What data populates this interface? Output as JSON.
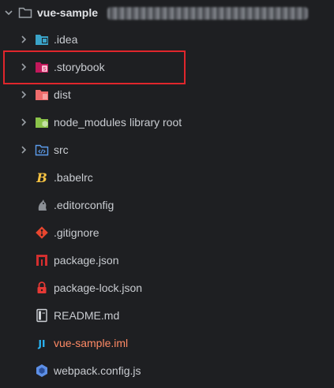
{
  "root": {
    "label": "vue-sample"
  },
  "items": [
    {
      "label": ".idea",
      "icon": "idea-folder-icon",
      "expandable": true
    },
    {
      "label": ".storybook",
      "icon": "storybook-folder-icon",
      "expandable": true
    },
    {
      "label": "dist",
      "icon": "dist-folder-icon",
      "expandable": true
    },
    {
      "label": "node_modules",
      "secondary": "library root",
      "icon": "node-modules-folder-icon",
      "expandable": true
    },
    {
      "label": "src",
      "icon": "src-folder-icon",
      "expandable": true
    },
    {
      "label": ".babelrc",
      "icon": "babel-icon",
      "expandable": false
    },
    {
      "label": ".editorconfig",
      "icon": "editorconfig-icon",
      "expandable": false
    },
    {
      "label": ".gitignore",
      "icon": "git-icon",
      "expandable": false
    },
    {
      "label": "package.json",
      "icon": "npm-icon",
      "expandable": false
    },
    {
      "label": "package-lock.json",
      "icon": "lock-icon",
      "expandable": false
    },
    {
      "label": "README.md",
      "icon": "readme-icon",
      "expandable": false
    },
    {
      "label": "vue-sample.iml",
      "icon": "iml-icon",
      "expandable": false
    },
    {
      "label": "webpack.config.js",
      "icon": "webpack-icon",
      "expandable": false
    }
  ],
  "colors": {
    "background": "#1e1f22",
    "text": "#c9ccd1",
    "highlight": "#e0262c",
    "iml_text": "#ff8a65"
  }
}
